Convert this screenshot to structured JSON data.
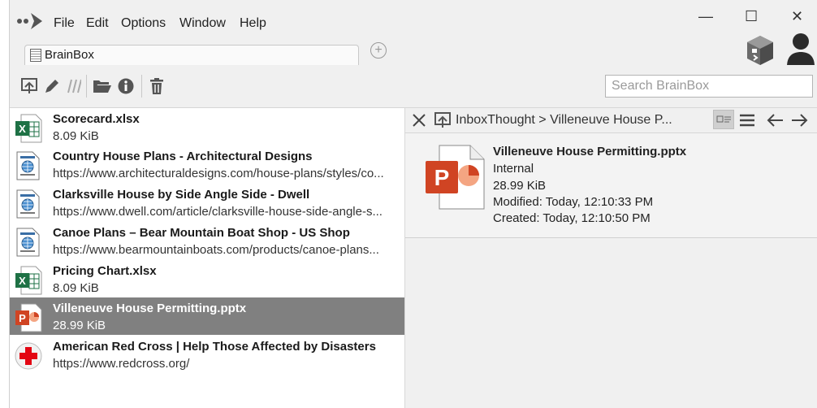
{
  "menu": {
    "items": [
      "File",
      "Edit",
      "Options",
      "Window",
      "Help"
    ]
  },
  "window_controls": {
    "minimize": "—",
    "maximize": "☐",
    "close": "✕"
  },
  "tab": {
    "label": "BrainBox",
    "add_symbol": "+"
  },
  "search": {
    "placeholder": "Search BrainBox",
    "value": ""
  },
  "list": {
    "items": [
      {
        "title": "Scorecard.xlsx",
        "subtitle": "8.09 KiB",
        "icon": "excel-file-icon",
        "selected": false
      },
      {
        "title": "Country House Plans - Architectural Designs",
        "subtitle": "https://www.architecturaldesigns.com/house-plans/styles/co...",
        "icon": "web-page-icon",
        "selected": false
      },
      {
        "title": "Clarksville House by Side Angle Side - Dwell",
        "subtitle": "https://www.dwell.com/article/clarksville-house-side-angle-s...",
        "icon": "web-page-icon",
        "selected": false
      },
      {
        "title": "Canoe Plans – Bear Mountain Boat Shop - US Shop",
        "subtitle": "https://www.bearmountainboats.com/products/canoe-plans...",
        "icon": "web-page-icon",
        "selected": false
      },
      {
        "title": "Pricing Chart.xlsx",
        "subtitle": "8.09 KiB",
        "icon": "excel-file-icon",
        "selected": false
      },
      {
        "title": "Villeneuve House Permitting.pptx",
        "subtitle": "28.99 KiB",
        "icon": "powerpoint-file-icon",
        "selected": true
      },
      {
        "title": "American Red Cross | Help Those Affected by Disasters",
        "subtitle": "https://www.redcross.org/",
        "icon": "red-cross-icon",
        "selected": false
      }
    ]
  },
  "preview": {
    "breadcrumb": "InboxThought > Villeneuve House P...",
    "file_name": "Villeneuve House Permitting.pptx",
    "location": "Internal",
    "size": "28.99 KiB",
    "modified": "Modified: Today, 12:10:33 PM",
    "created": "Created: Today, 12:10:50 PM"
  },
  "colors": {
    "selected_row": "#808080",
    "excel_green": "#1e7145",
    "ppt_red": "#d04423",
    "red_cross": "#e30613"
  }
}
